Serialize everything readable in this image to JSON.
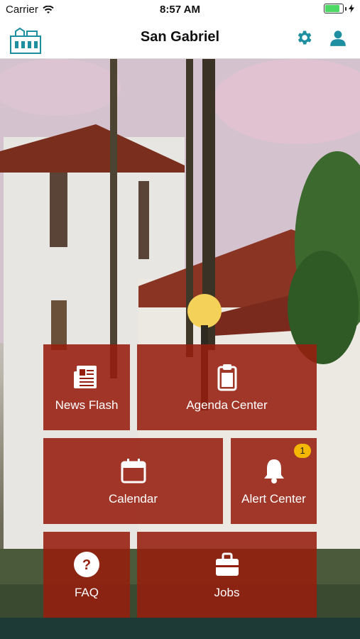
{
  "status": {
    "carrier": "Carrier",
    "time": "8:57 AM"
  },
  "header": {
    "title": "San Gabriel",
    "icons": [
      "mission-logo-icon",
      "gear-icon",
      "user-icon"
    ]
  },
  "tiles": [
    {
      "label": "News Flash",
      "icon": "news-icon"
    },
    {
      "label": "Agenda Center",
      "icon": "clipboard-icon"
    },
    {
      "label": "Calendar",
      "icon": "calendar-icon"
    },
    {
      "label": "Alert Center",
      "icon": "bell-icon",
      "badge": "1"
    },
    {
      "label": "FAQ",
      "icon": "question-icon"
    },
    {
      "label": "Jobs",
      "icon": "briefcase-icon"
    }
  ],
  "colors": {
    "accent": "#1e8fa0",
    "tile": "#961e0e",
    "badge": "#f5b800"
  }
}
